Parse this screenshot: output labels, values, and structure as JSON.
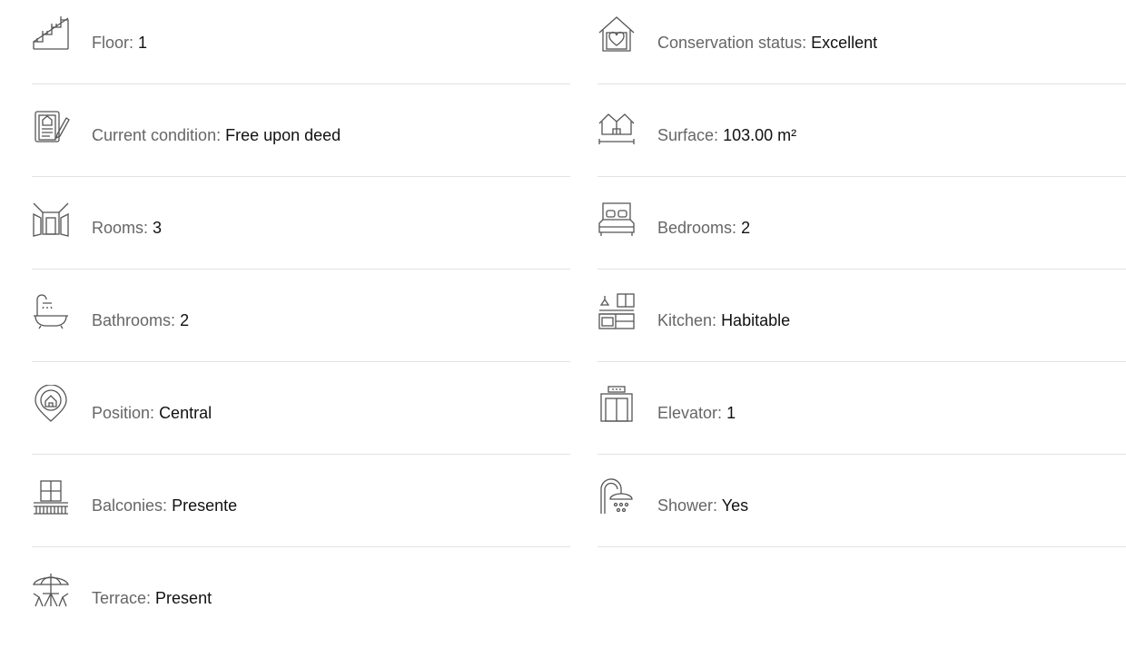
{
  "features": {
    "left": [
      {
        "label": "Floor:",
        "value": "1",
        "icon": "stairs-icon"
      },
      {
        "label": "Current condition:",
        "value": "Free upon deed",
        "icon": "document-icon"
      },
      {
        "label": "Rooms:",
        "value": "3",
        "icon": "rooms-icon"
      },
      {
        "label": "Bathrooms:",
        "value": "2",
        "icon": "bathtub-icon"
      },
      {
        "label": "Position:",
        "value": "Central",
        "icon": "location-pin-icon"
      },
      {
        "label": "Balconies:",
        "value": "Presente",
        "icon": "balcony-icon"
      },
      {
        "label": "Terrace:",
        "value": "Present",
        "icon": "terrace-icon"
      }
    ],
    "right": [
      {
        "label": "Conservation status:",
        "value": "Excellent",
        "icon": "house-heart-icon"
      },
      {
        "label": "Surface:",
        "value": "103.00 m²",
        "icon": "surface-icon"
      },
      {
        "label": "Bedrooms:",
        "value": "2",
        "icon": "bed-icon"
      },
      {
        "label": "Kitchen:",
        "value": "Habitable",
        "icon": "kitchen-icon"
      },
      {
        "label": "Elevator:",
        "value": "1",
        "icon": "elevator-icon"
      },
      {
        "label": "Shower:",
        "value": "Yes",
        "icon": "shower-icon"
      }
    ]
  },
  "colors": {
    "label": "#666666",
    "value": "#111111",
    "icon": "#555555",
    "divider": "#e2e2e2"
  }
}
